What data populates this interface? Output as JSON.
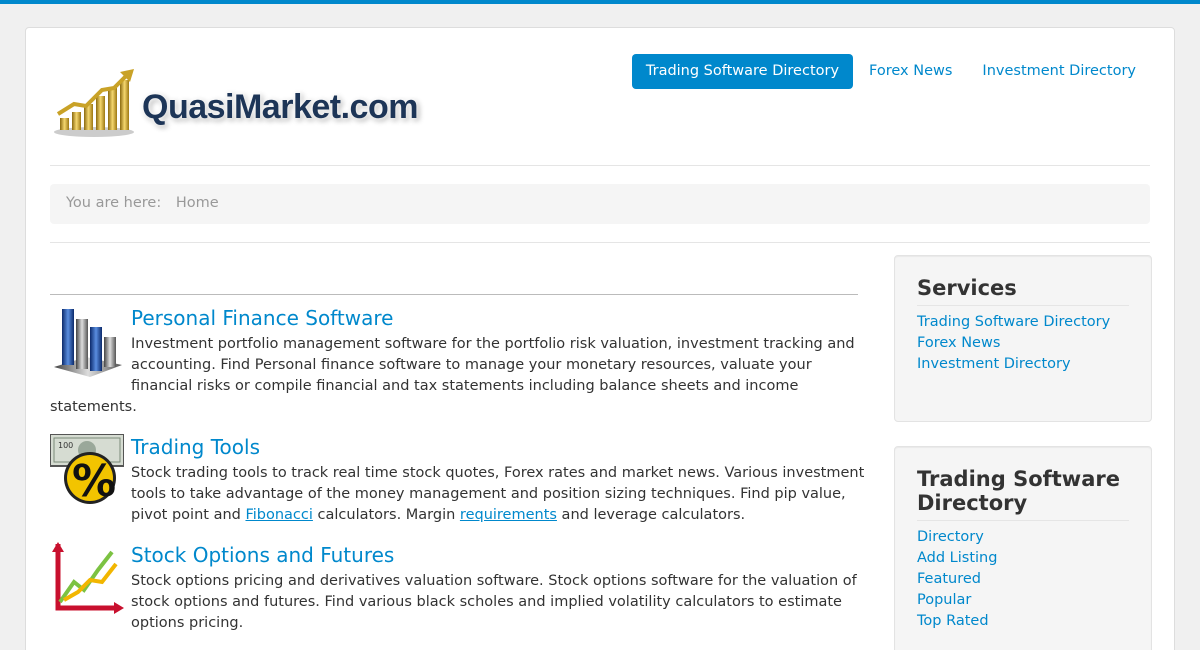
{
  "header": {
    "logo_text": "QuasiMarket.com",
    "nav": [
      {
        "label": "Trading Software Directory",
        "active": true
      },
      {
        "label": "Forex News",
        "active": false
      },
      {
        "label": "Investment Directory",
        "active": false
      }
    ]
  },
  "breadcrumb": {
    "prefix": "You are here:",
    "current": "Home"
  },
  "articles": [
    {
      "icon": "bar-chart-icon",
      "title": "Personal Finance Software",
      "text": "Investment portfolio management software for the portfolio risk valuation, investment tracking and accounting. Find Personal finance software to manage your monetary resources, valuate your financial risks or compile financial and tax statements including balance sheets and income statements."
    },
    {
      "icon": "dollar-percent-icon",
      "title": "Trading Tools",
      "text_before": "Stock trading tools to track real time stock quotes, Forex rates and market news. Various investment tools to take advantage of the money management and position sizing techniques. Find pip value, pivot point and ",
      "link1": "Fibonacci",
      "text_mid": " calculators. Margin ",
      "link2": "requirements",
      "text_after": " and leverage calculators."
    },
    {
      "icon": "line-graph-icon",
      "title": "Stock Options and Futures",
      "text": "Stock options pricing and derivatives valuation software. Stock options software for the valuation of stock options and futures. Find various black scholes and implied volatility calculators to estimate options pricing."
    }
  ],
  "sidebar": {
    "services": {
      "title": "Services",
      "links": [
        "Trading Software Directory",
        "Forex News",
        "Investment Directory"
      ]
    },
    "directory": {
      "title": "Trading Software Directory",
      "links": [
        "Directory",
        "Add Listing",
        "Featured",
        "Popular",
        "Top Rated"
      ]
    }
  },
  "colors": {
    "accent": "#0088cc",
    "well": "#f5f5f5"
  }
}
